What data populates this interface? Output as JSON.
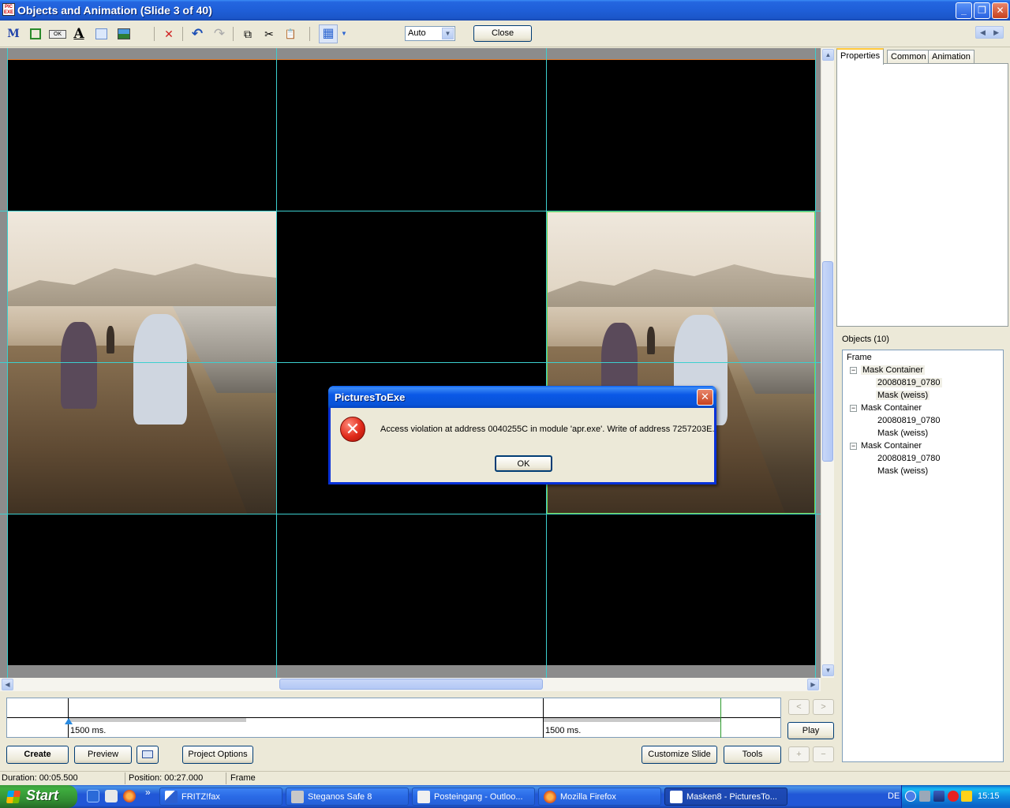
{
  "window": {
    "title": "Objects and Animation  (Slide 3 of 40)",
    "app_icon_text": "PIC EXE",
    "minimize": "_",
    "restore": "❐",
    "close": "✕"
  },
  "toolbar": {
    "icons": [
      "mask-icon",
      "frame-icon",
      "button-icon",
      "text-icon",
      "rectangle-icon",
      "image-icon",
      "delete-icon",
      "undo-icon",
      "redo-icon",
      "copy-icon",
      "cut-icon",
      "paste-icon",
      "grid-icon"
    ],
    "mask_glyph": "M",
    "button_glyph": "OK",
    "text_glyph": "A",
    "delete_glyph": "✕",
    "undo_glyph": "↶",
    "redo_glyph": "↷",
    "copy_glyph": "⧉",
    "cut_glyph": "✂",
    "paste_glyph": "📋",
    "grid_glyph": "▦",
    "zoom_value": "Auto",
    "close_label": "Close",
    "nav_prev": "◀",
    "nav_next": "▶"
  },
  "tabs": [
    {
      "label": "Properties",
      "active": true
    },
    {
      "label": "Common",
      "active": false
    },
    {
      "label": "Animation",
      "active": false
    }
  ],
  "objects": {
    "label": "Objects (10)",
    "tree": [
      {
        "label": "Frame",
        "level": 0
      },
      {
        "label": "Mask Container",
        "level": 1,
        "expander": "−"
      },
      {
        "label": "20080819_0780",
        "level": 2
      },
      {
        "label": "Mask (weiss)",
        "level": 2
      },
      {
        "label": "Mask Container",
        "level": 1,
        "expander": "−"
      },
      {
        "label": "20080819_0780",
        "level": 2
      },
      {
        "label": "Mask (weiss)",
        "level": 2
      },
      {
        "label": "Mask Container",
        "level": 1,
        "expander": "−"
      },
      {
        "label": "20080819_0780",
        "level": 2
      },
      {
        "label": "Mask (weiss)",
        "level": 2
      }
    ]
  },
  "timeline": {
    "label_1": "1500 ms.",
    "label_2": "1500 ms.",
    "prev": "<",
    "next": ">",
    "play_label": "Play",
    "plus": "+",
    "minus": "−"
  },
  "bottom_buttons": {
    "create": "Create",
    "preview": "Preview",
    "project_options": "Project Options",
    "customize_slide": "Customize Slide",
    "tools": "Tools"
  },
  "status": {
    "duration": "Duration:  00:05.500",
    "position": "Position:  00:27.000",
    "object": "Frame"
  },
  "dialog": {
    "title": "PicturesToExe",
    "message": "Access violation at address 0040255C in module 'apr.exe'. Write of address 7257203E.",
    "ok_label": "OK",
    "error_glyph": "✕",
    "close_glyph": "✕"
  },
  "taskbar": {
    "start_label": "Start",
    "more": "»",
    "tasks": [
      {
        "label": "FRITZ!fax",
        "active": false
      },
      {
        "label": "Steganos Safe 8",
        "active": false
      },
      {
        "label": "Posteingang - Outloo...",
        "active": false
      },
      {
        "label": "Mozilla Firefox",
        "active": false
      },
      {
        "label": "Masken8 - PicturesTo...",
        "active": true
      }
    ],
    "language": "DE",
    "clock": "15:15"
  },
  "scroll": {
    "up": "▲",
    "down": "▼",
    "left": "◀",
    "right": "▶"
  },
  "colors": {
    "grid_line": "#3ccfcf",
    "selection": "#7fd14a",
    "title_blue": "#1f5fd8"
  }
}
